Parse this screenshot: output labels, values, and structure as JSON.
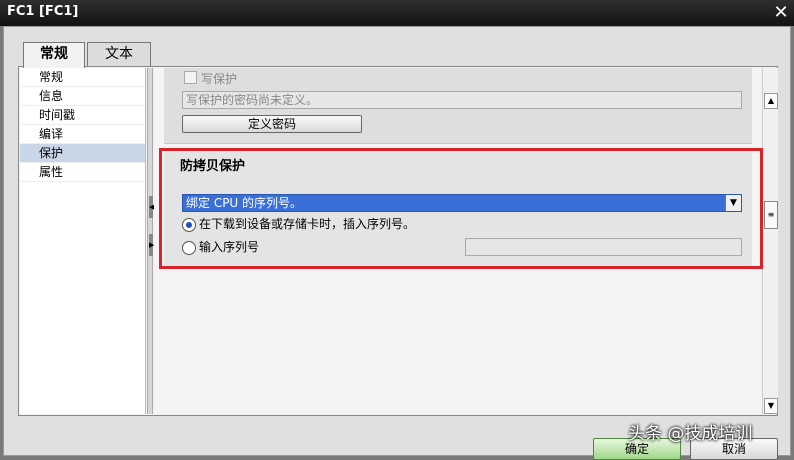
{
  "window": {
    "title": "FC1 [FC1]",
    "close_glyph": "✕"
  },
  "tabs": [
    {
      "label": "常规",
      "active": true
    },
    {
      "label": "文本",
      "active": false
    }
  ],
  "nav": {
    "items": [
      "常规",
      "信息",
      "时间戳",
      "编译",
      "保护",
      "属性"
    ],
    "selected": "保护"
  },
  "write_protect": {
    "checkbox_label": "写保护",
    "password_status": "写保护的密码尚未定义。",
    "define_password_button": "定义密码"
  },
  "copy_protection": {
    "title": "防拷贝保护",
    "binding_selected": "绑定 CPU 的序列号。",
    "radio_options": [
      {
        "label": "在下载到设备或存储卡时，插入序列号。",
        "selected": true
      },
      {
        "label": "输入序列号",
        "selected": false
      }
    ],
    "serial_value": ""
  },
  "footer": {
    "ok_label": "确定",
    "cancel_label": "取消"
  },
  "watermark": "头条 @技成培训",
  "colors": {
    "accent": "#3a6fd8",
    "highlight": "#d8232a"
  }
}
